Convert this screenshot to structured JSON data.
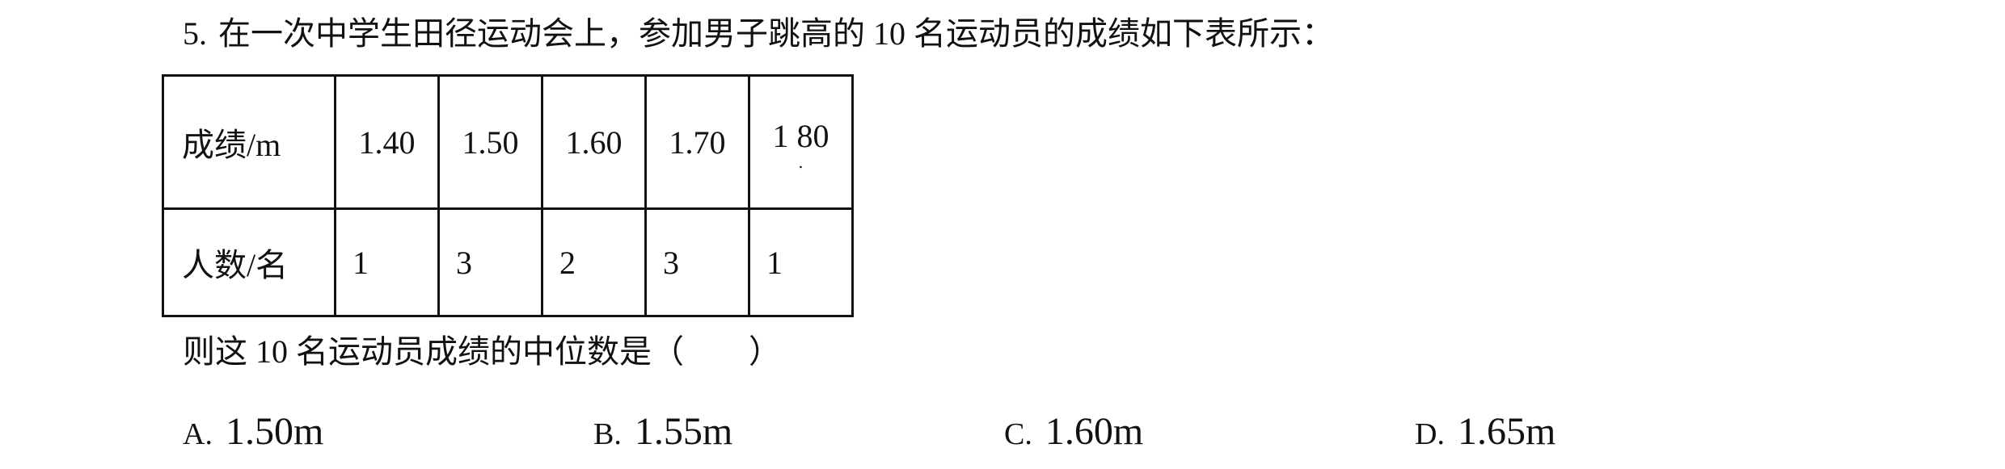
{
  "question": {
    "number": "5.",
    "text": "在一次中学生田径运动会上，参加男子跳高的 10 名运动员的成绩如下表所示："
  },
  "table": {
    "rows": [
      {
        "header": "成绩/m",
        "cells": [
          "1.40",
          "1.50",
          "1.60",
          "1.70",
          "1 80"
        ]
      },
      {
        "header": "人数/名",
        "cells": [
          "1",
          "3",
          "2",
          "3",
          "1"
        ]
      }
    ]
  },
  "prompt": "则这 10 名运动员成绩的中位数是（　　）",
  "options": [
    {
      "letter": "A.",
      "value": "1.50m"
    },
    {
      "letter": "B.",
      "value": "1.55m"
    },
    {
      "letter": "C.",
      "value": "1.60m"
    },
    {
      "letter": "D.",
      "value": "1.65m"
    }
  ]
}
